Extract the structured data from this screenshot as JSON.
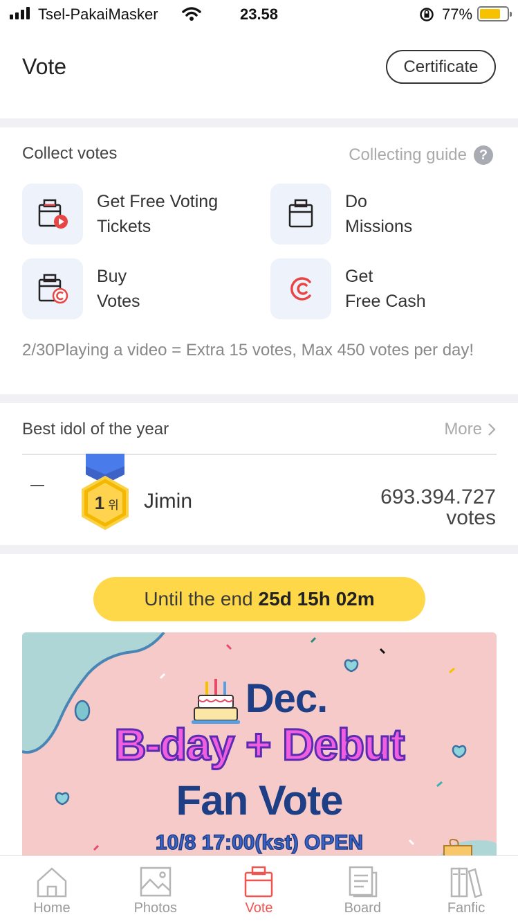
{
  "status_bar": {
    "carrier": "Tsel-PakaiMasker",
    "time": "23.58",
    "battery": "77%",
    "battery_level": 0.77
  },
  "header": {
    "title": "Vote",
    "certificate_label": "Certificate"
  },
  "collect": {
    "title": "Collect votes",
    "guide_label": "Collecting guide",
    "guide_icon": "question-icon",
    "actions": [
      {
        "line1": "Get Free Voting",
        "line2": "Tickets",
        "icon": "ballot-box-play-icon"
      },
      {
        "line1": "Do",
        "line2": "Missions",
        "icon": "ballot-box-icon"
      },
      {
        "line1": "Buy",
        "line2": "Votes",
        "icon": "ballot-box-coin-icon"
      },
      {
        "line1": "Get",
        "line2": "Free Cash",
        "icon": "cash-icon"
      }
    ],
    "bonus_text": "2/30Playing a video = Extra 15 votes, Max 450 votes per day!"
  },
  "ranking": {
    "title": "Best idol of the year",
    "more_label": "More",
    "entry": {
      "rank_change": "—",
      "badge_number": "1",
      "badge_suffix": "위",
      "name": "Jimin",
      "votes_number": "693.394.727",
      "votes_unit": "votes"
    }
  },
  "timer": {
    "prefix": "Until the end",
    "remaining": "25d 15h 02m"
  },
  "banner": {
    "line1": "Dec.",
    "line2": "B-day + Debut",
    "line3": "Fan Vote",
    "line4": "10/8 17:00(kst) OPEN"
  },
  "tabs": [
    {
      "label": "Home",
      "icon": "home-icon",
      "active": false
    },
    {
      "label": "Photos",
      "icon": "photos-icon",
      "active": false
    },
    {
      "label": "Vote",
      "icon": "vote-icon",
      "active": true
    },
    {
      "label": "Board",
      "icon": "board-icon",
      "active": false
    },
    {
      "label": "Fanfic",
      "icon": "fanfic-icon",
      "active": false
    }
  ],
  "colors": {
    "accent": "#ee5551",
    "timer_yellow": "#ffd84a",
    "banner_bg": "#f6cac8",
    "navy": "#1e3f86",
    "pink": "#f05fe0"
  }
}
